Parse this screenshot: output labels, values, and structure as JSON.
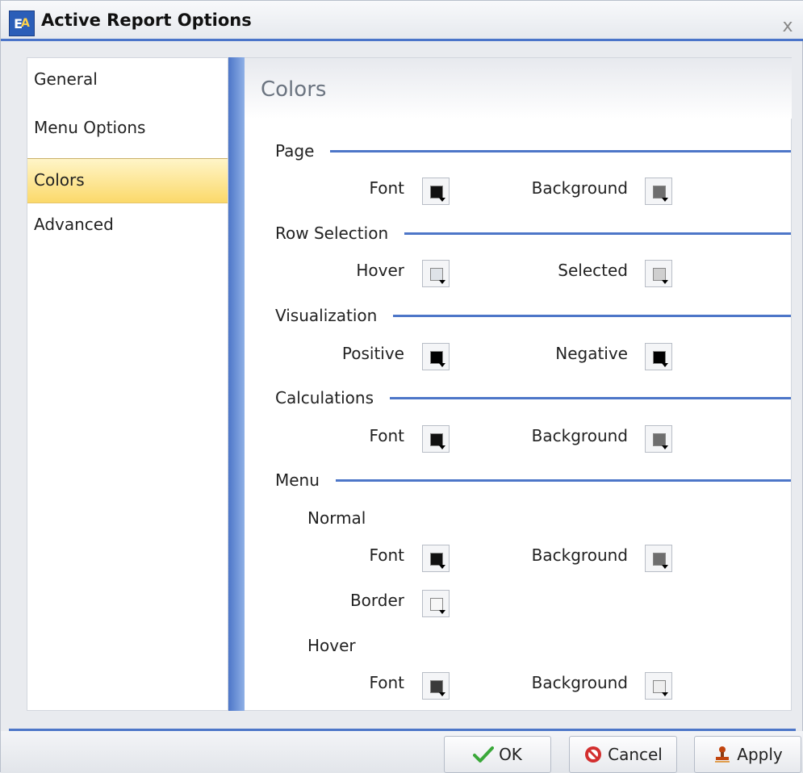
{
  "window": {
    "title": "Active Report Options",
    "icon_name": "active-report-app-icon",
    "close_label": "x"
  },
  "nav": {
    "items": [
      {
        "label": "General",
        "selected": false
      },
      {
        "label": "Menu Options",
        "selected": false
      },
      {
        "label": "Colors",
        "selected": true
      },
      {
        "label": "Advanced",
        "selected": false
      }
    ]
  },
  "content": {
    "title": "Colors",
    "sections": {
      "page": {
        "label": "Page",
        "font": {
          "label": "Font",
          "color": "#111111"
        },
        "background": {
          "label": "Background",
          "color": "#6e6e6e"
        }
      },
      "row_selection": {
        "label": "Row Selection",
        "hover": {
          "label": "Hover",
          "color": "#dfe3e8"
        },
        "selected": {
          "label": "Selected",
          "color": "#cfcfcf"
        }
      },
      "visualization": {
        "label": "Visualization",
        "positive": {
          "label": "Positive",
          "color": "#000000"
        },
        "negative": {
          "label": "Negative",
          "color": "#000000"
        }
      },
      "calculations": {
        "label": "Calculations",
        "font": {
          "label": "Font",
          "color": "#111111"
        },
        "background": {
          "label": "Background",
          "color": "#6e6e6e"
        }
      },
      "menu": {
        "label": "Menu",
        "normal": {
          "label": "Normal",
          "font": {
            "label": "Font",
            "color": "#111111"
          },
          "background": {
            "label": "Background",
            "color": "#6e6e6e"
          },
          "border": {
            "label": "Border",
            "color": "#f7f7f7"
          }
        },
        "hover": {
          "label": "Hover",
          "font": {
            "label": "Font",
            "color": "#3a3a3a"
          },
          "background": {
            "label": "Background",
            "color": "#eeeeee"
          }
        }
      }
    }
  },
  "footer": {
    "ok_label": "OK",
    "cancel_label": "Cancel",
    "apply_label": "Apply"
  },
  "colors": {
    "accent": "#4d76c8",
    "selected_nav": "#fbd96a"
  }
}
